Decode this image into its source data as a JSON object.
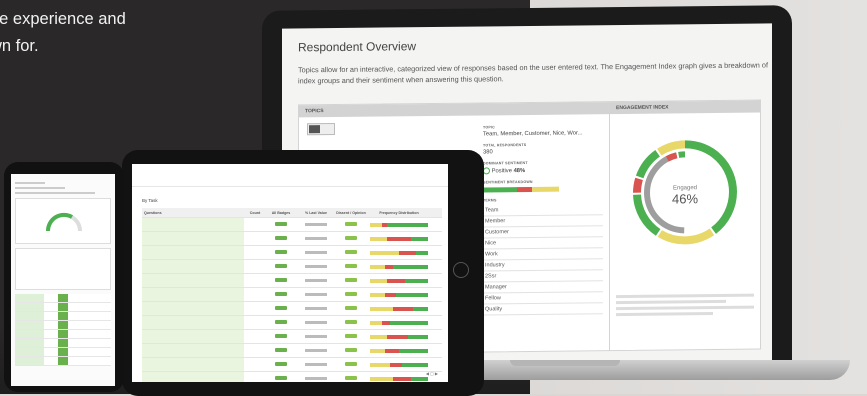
{
  "hero": {
    "line1": "ee experience and",
    "line2": "wn for."
  },
  "laptop": {
    "title": "Respondent Overview",
    "description": "Topics allow for an interactive, categorized view of responses based on the user entered text. The Engagement Index graph gives a breakdown of index groups and their sentiment when answering this question.",
    "topics_header": "TOPICS",
    "engagement_header": "ENGAGEMENT INDEX",
    "topic_label": "TOPIC",
    "topic_value": "Team, Member, Customer, Nice, Wor...",
    "total_label": "TOTAL RESPONDENTS",
    "total_value": "380",
    "dominant_label": "DOMINANT SENTIMENT",
    "dominant_value": "Positive",
    "dominant_pct": "48%",
    "breakdown_label": "SENTIMENT BREAKDOWN",
    "terms_label": "TERMS",
    "terms": [
      "Team",
      "Member",
      "Customer",
      "Nice",
      "Work",
      "Industry",
      "2Ssr",
      "Manager",
      "Fellow",
      "Quality"
    ],
    "donut_center_label": "Engaged",
    "donut_center_value": "46%",
    "colors": {
      "positive": "#4caf50",
      "negative": "#d9534f",
      "neutral": "#e8d86a",
      "gray": "#9e9e9e"
    }
  },
  "tablet": {
    "section_title": "By Task",
    "columns": [
      "Questions",
      "Count",
      "All Badges",
      "% Last Value",
      "Dissent / Opinion",
      "Frequency Distribution"
    ]
  },
  "icons": {
    "toggle": "view-toggle-icon",
    "home": "home-button-icon"
  }
}
